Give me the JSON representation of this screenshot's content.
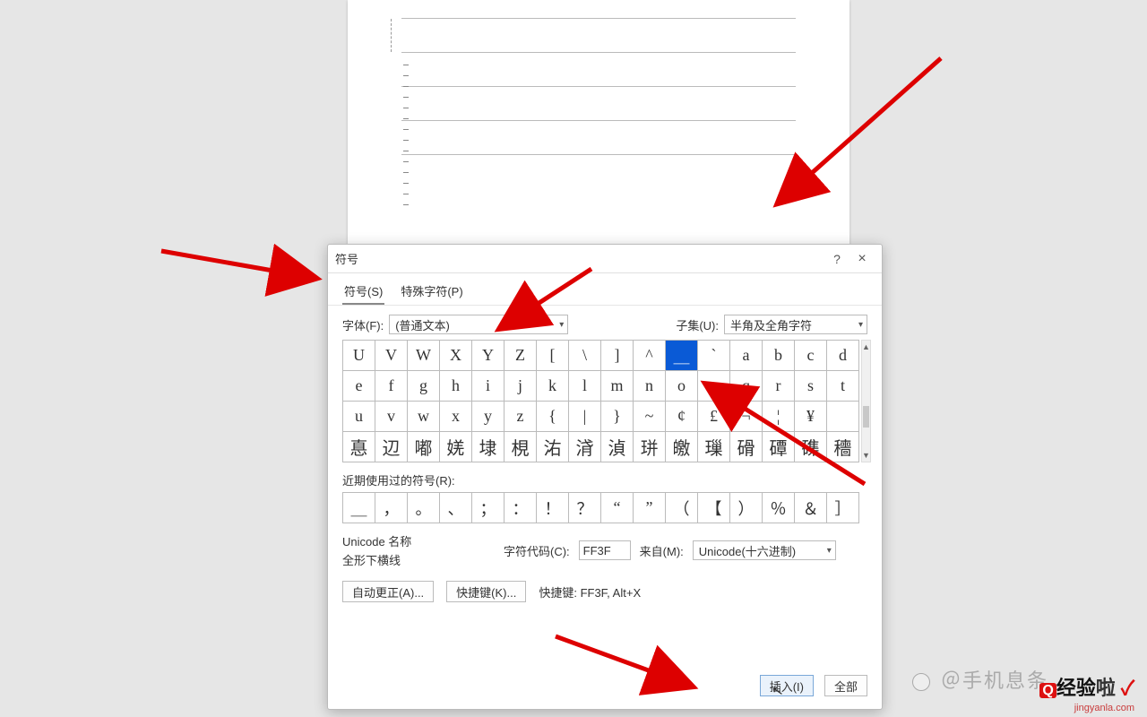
{
  "dialog": {
    "title": "符号",
    "help": "?",
    "close": "×",
    "tabs": {
      "symbols": "符号(S)",
      "special": "特殊字符(P)"
    },
    "font_label": "字体(F):",
    "font_value": "(普通文本)",
    "subset_label": "子集(U):",
    "subset_value": "半角及全角字符",
    "recent_label": "近期使用过的符号(R):",
    "unicode_name_label": "Unicode 名称",
    "unicode_name_value": "全形下横线",
    "char_code_label": "字符代码(C):",
    "char_code_value": "FF3F",
    "from_label": "来自(M):",
    "from_value": "Unicode(十六进制)",
    "autocorrect_btn": "自动更正(A)...",
    "shortcut_btn": "快捷键(K)...",
    "shortcut_label": "快捷键: FF3F, Alt+X",
    "insert_btn": "插入(I)",
    "cancel_btn": "全部"
  },
  "grid": {
    "row1": [
      "U",
      "V",
      "W",
      "X",
      "Y",
      "Z",
      "[",
      "\\",
      "]",
      "^",
      "＿",
      "`",
      "a",
      "b",
      "c",
      "d"
    ],
    "row2": [
      "e",
      "f",
      "g",
      "h",
      "i",
      "j",
      "k",
      "l",
      "m",
      "n",
      "o",
      "p",
      "q",
      "r",
      "s",
      "t"
    ],
    "row3": [
      "u",
      "v",
      "w",
      "x",
      "y",
      "z",
      "{",
      "|",
      "}",
      "~",
      "¢",
      "£",
      "¬",
      "¦",
      "¥",
      ""
    ],
    "row4": [
      "惪",
      "辺",
      "嘟",
      "㛨",
      "埭",
      "梘",
      "㳓",
      "浳",
      "湞",
      "㻂",
      "皦",
      "璅",
      "磆",
      "磹",
      "磼",
      "穯"
    ],
    "selected_index": 10
  },
  "recent": [
    "＿",
    "，",
    "。",
    "、",
    "；",
    "：",
    "！",
    "？",
    "“",
    "”",
    "（",
    "【",
    "）",
    "％",
    "＆",
    "］"
  ],
  "watermark": {
    "line1": "＠手机息条",
    "brand_prefix": "经验",
    "brand_suffix": "啦",
    "url": "jingyanla.com"
  }
}
